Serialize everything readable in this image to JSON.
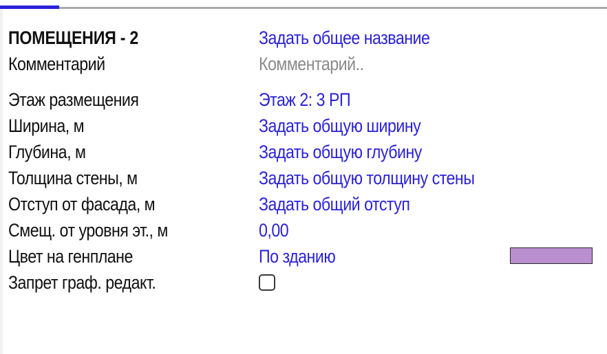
{
  "section": {
    "title": "ПОМЕЩЕНИЯ - 2",
    "title_value": "Задать общее название"
  },
  "colors": {
    "accent": "#2b22d8",
    "placeholder": "#8a8a8a",
    "swatch": "#b98fcf"
  },
  "rows": {
    "comment": {
      "label": "Комментарий",
      "placeholder": "Комментарий.."
    },
    "floor": {
      "label": "Этаж размещения",
      "value": "Этаж 2: 3 РП"
    },
    "width": {
      "label": "Ширина, м",
      "value": "Задать общую ширину"
    },
    "depth": {
      "label": "Глубина, м",
      "value": "Задать общую глубину"
    },
    "wall": {
      "label": "Толщина стены, м",
      "value": "Задать общую толщину стены"
    },
    "offset": {
      "label": "Отступ от фасада, м",
      "value": "Задать общий отступ"
    },
    "shift": {
      "label": "Смещ. от уровня эт., м",
      "value": "0,00"
    },
    "color": {
      "label": "Цвет на генплане",
      "value": "По зданию"
    },
    "lock": {
      "label": "Запрет граф. редакт.",
      "checked": false
    }
  }
}
